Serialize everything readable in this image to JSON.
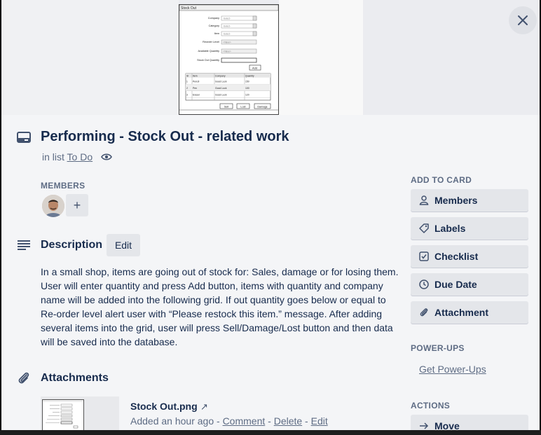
{
  "card": {
    "title": "Performing - Stock Out - related work",
    "in_list_prefix": "in list",
    "list_name": "To Do"
  },
  "members": {
    "label": "MEMBERS",
    "add_symbol": "+"
  },
  "description": {
    "title": "Description",
    "edit_label": "Edit",
    "lines": [
      "In a small shop, items are going out of stock for: Sales, damage or for losing them.",
      "User will enter quantity and press Add button, items with quantity and company",
      "name will be added into the following grid. If out quantity goes below or equal to",
      "Re-order level alert user with “Please restock this item.” message. After adding",
      "several items into the grid, user will press Sell/Damage/Lost button and then data",
      "will be saved into the database."
    ]
  },
  "attachments": {
    "title": "Attachments",
    "file_name": "Stock Out.png",
    "arrow": "↗",
    "added": "Added an hour ago",
    "sep": " - ",
    "comment": "Comment",
    "delete": "Delete",
    "edit": "Edit"
  },
  "sidebar": {
    "add_to_card_label": "ADD TO CARD",
    "buttons": [
      {
        "label": "Members",
        "icon": "person-icon"
      },
      {
        "label": "Labels",
        "icon": "tag-icon"
      },
      {
        "label": "Checklist",
        "icon": "checkbox-icon"
      },
      {
        "label": "Due Date",
        "icon": "clock-icon"
      },
      {
        "label": "Attachment",
        "icon": "paperclip-icon"
      }
    ],
    "powerups_label": "POWER-UPS",
    "get_powerups": "Get Power-Ups",
    "actions_label": "ACTIONS",
    "move_label": "Move"
  },
  "cover_mock": {
    "window_title": "Stock Out",
    "fields": [
      "Company",
      "Category",
      "Item",
      "Reorder Level",
      "Available Quantity",
      "Stock Out Quantity"
    ],
    "select_placeholder": "-Select-",
    "value_placeholder": "<Value>",
    "add_label": "Add",
    "grid_headers": [
      "Sl",
      "Item",
      "Company",
      "Quantity"
    ],
    "grid_rows": [
      [
        "1",
        "Pencil",
        "Good Luck",
        "150"
      ],
      [
        "2",
        "Pen",
        "Good Luck",
        "100"
      ],
      [
        "3",
        "Eraser",
        "Good Luck",
        "120"
      ]
    ],
    "action_buttons": [
      "Sell",
      "Lost",
      "Damage"
    ]
  },
  "colors": {
    "background": "#f4f5f7",
    "button_bg": "#e4e6ea",
    "text": "#172b4d",
    "muted": "#5e6c84"
  }
}
